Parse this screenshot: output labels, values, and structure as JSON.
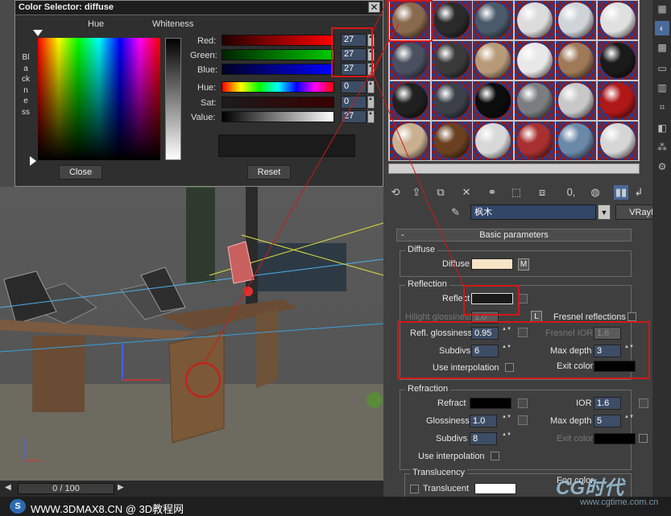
{
  "dialog": {
    "title": "Color Selector: diffuse",
    "close_glyph": "✕",
    "hue_label": "Hue",
    "whiteness_label": "Whiteness",
    "blackness_label": "Blackness",
    "red_label": "Red:",
    "green_label": "Green:",
    "blue_label": "Blue:",
    "hue2_label": "Hue:",
    "sat_label": "Sat:",
    "value_label": "Value:",
    "red_value": "27",
    "green_value": "27",
    "blue_value": "27",
    "hue_value": "0",
    "sat_value": "0",
    "value_value": "27",
    "close_button": "Close",
    "reset_button": "Reset"
  },
  "material": {
    "name": "枫木",
    "type_button": "VRayMtl",
    "toolbar_number": "0,"
  },
  "rollout": {
    "title": "Basic parameters",
    "collapse_glyph": "-"
  },
  "diffuse": {
    "group": "Diffuse",
    "label": "Diffuse",
    "color": "#f7e3c6",
    "m": "M"
  },
  "reflection": {
    "group": "Reflection",
    "reflect_label": "Reflect",
    "reflect_color": "#1b1b1b",
    "hilight_label": "Hilight glossiness",
    "hilight_value": "1.0",
    "lock_label": "L",
    "fresnel_label": "Fresnel reflections",
    "refl_gloss_label": "Refl. glossiness",
    "refl_gloss_value": "0.95",
    "fresnel_ior_label": "Fresnel IOR",
    "fresnel_ior_value": "1.6",
    "subdivs_label": "Subdivs",
    "subdivs_value": "6",
    "max_depth_label": "Max depth",
    "max_depth_value": "3",
    "use_interp_label": "Use interpolation",
    "exit_color_label": "Exit color",
    "exit_color": "#000000"
  },
  "refraction": {
    "group": "Refraction",
    "refract_label": "Refract",
    "refract_color": "#000000",
    "ior_label": "IOR",
    "ior_value": "1.6",
    "gloss_label": "Glossiness",
    "gloss_value": "1.0",
    "max_depth_label": "Max depth",
    "max_depth_value": "5",
    "subdivs_label": "Subdivs",
    "subdivs_value": "8",
    "exit_color_label": "Exit color",
    "exit_color": "#000000",
    "use_interp_label": "Use interpolation"
  },
  "translucency": {
    "group": "Translucency",
    "label": "Translucent",
    "fog_label": "Fog color",
    "color": "#ffffff"
  },
  "timeline": {
    "frame": "0 / 100"
  },
  "footer": {
    "logo": "S",
    "text": "WWW.3DMAX8.CN @ 3D教程网",
    "watermark": "CG时代",
    "watermark_url": "www.cgtime.com.cn"
  },
  "materials_palette": [
    "#8a6a4e",
    "#2a2a2a",
    "#4a5a6a",
    "#dcdcdc",
    "#cfd4d8",
    "#e0e0e0",
    "#4a5060",
    "#3a3a3a",
    "#b89a78",
    "#e8e8e8",
    "#a07a58",
    "#1a1a1a",
    "#202020",
    "#3c4048",
    "#0c0c0c",
    "#7a7e80",
    "#c8c8c8",
    "#b01818",
    "#c8b090",
    "#6a4020",
    "#d8d8d8",
    "#a83030",
    "#6a88a8",
    "#d6d6d6"
  ]
}
